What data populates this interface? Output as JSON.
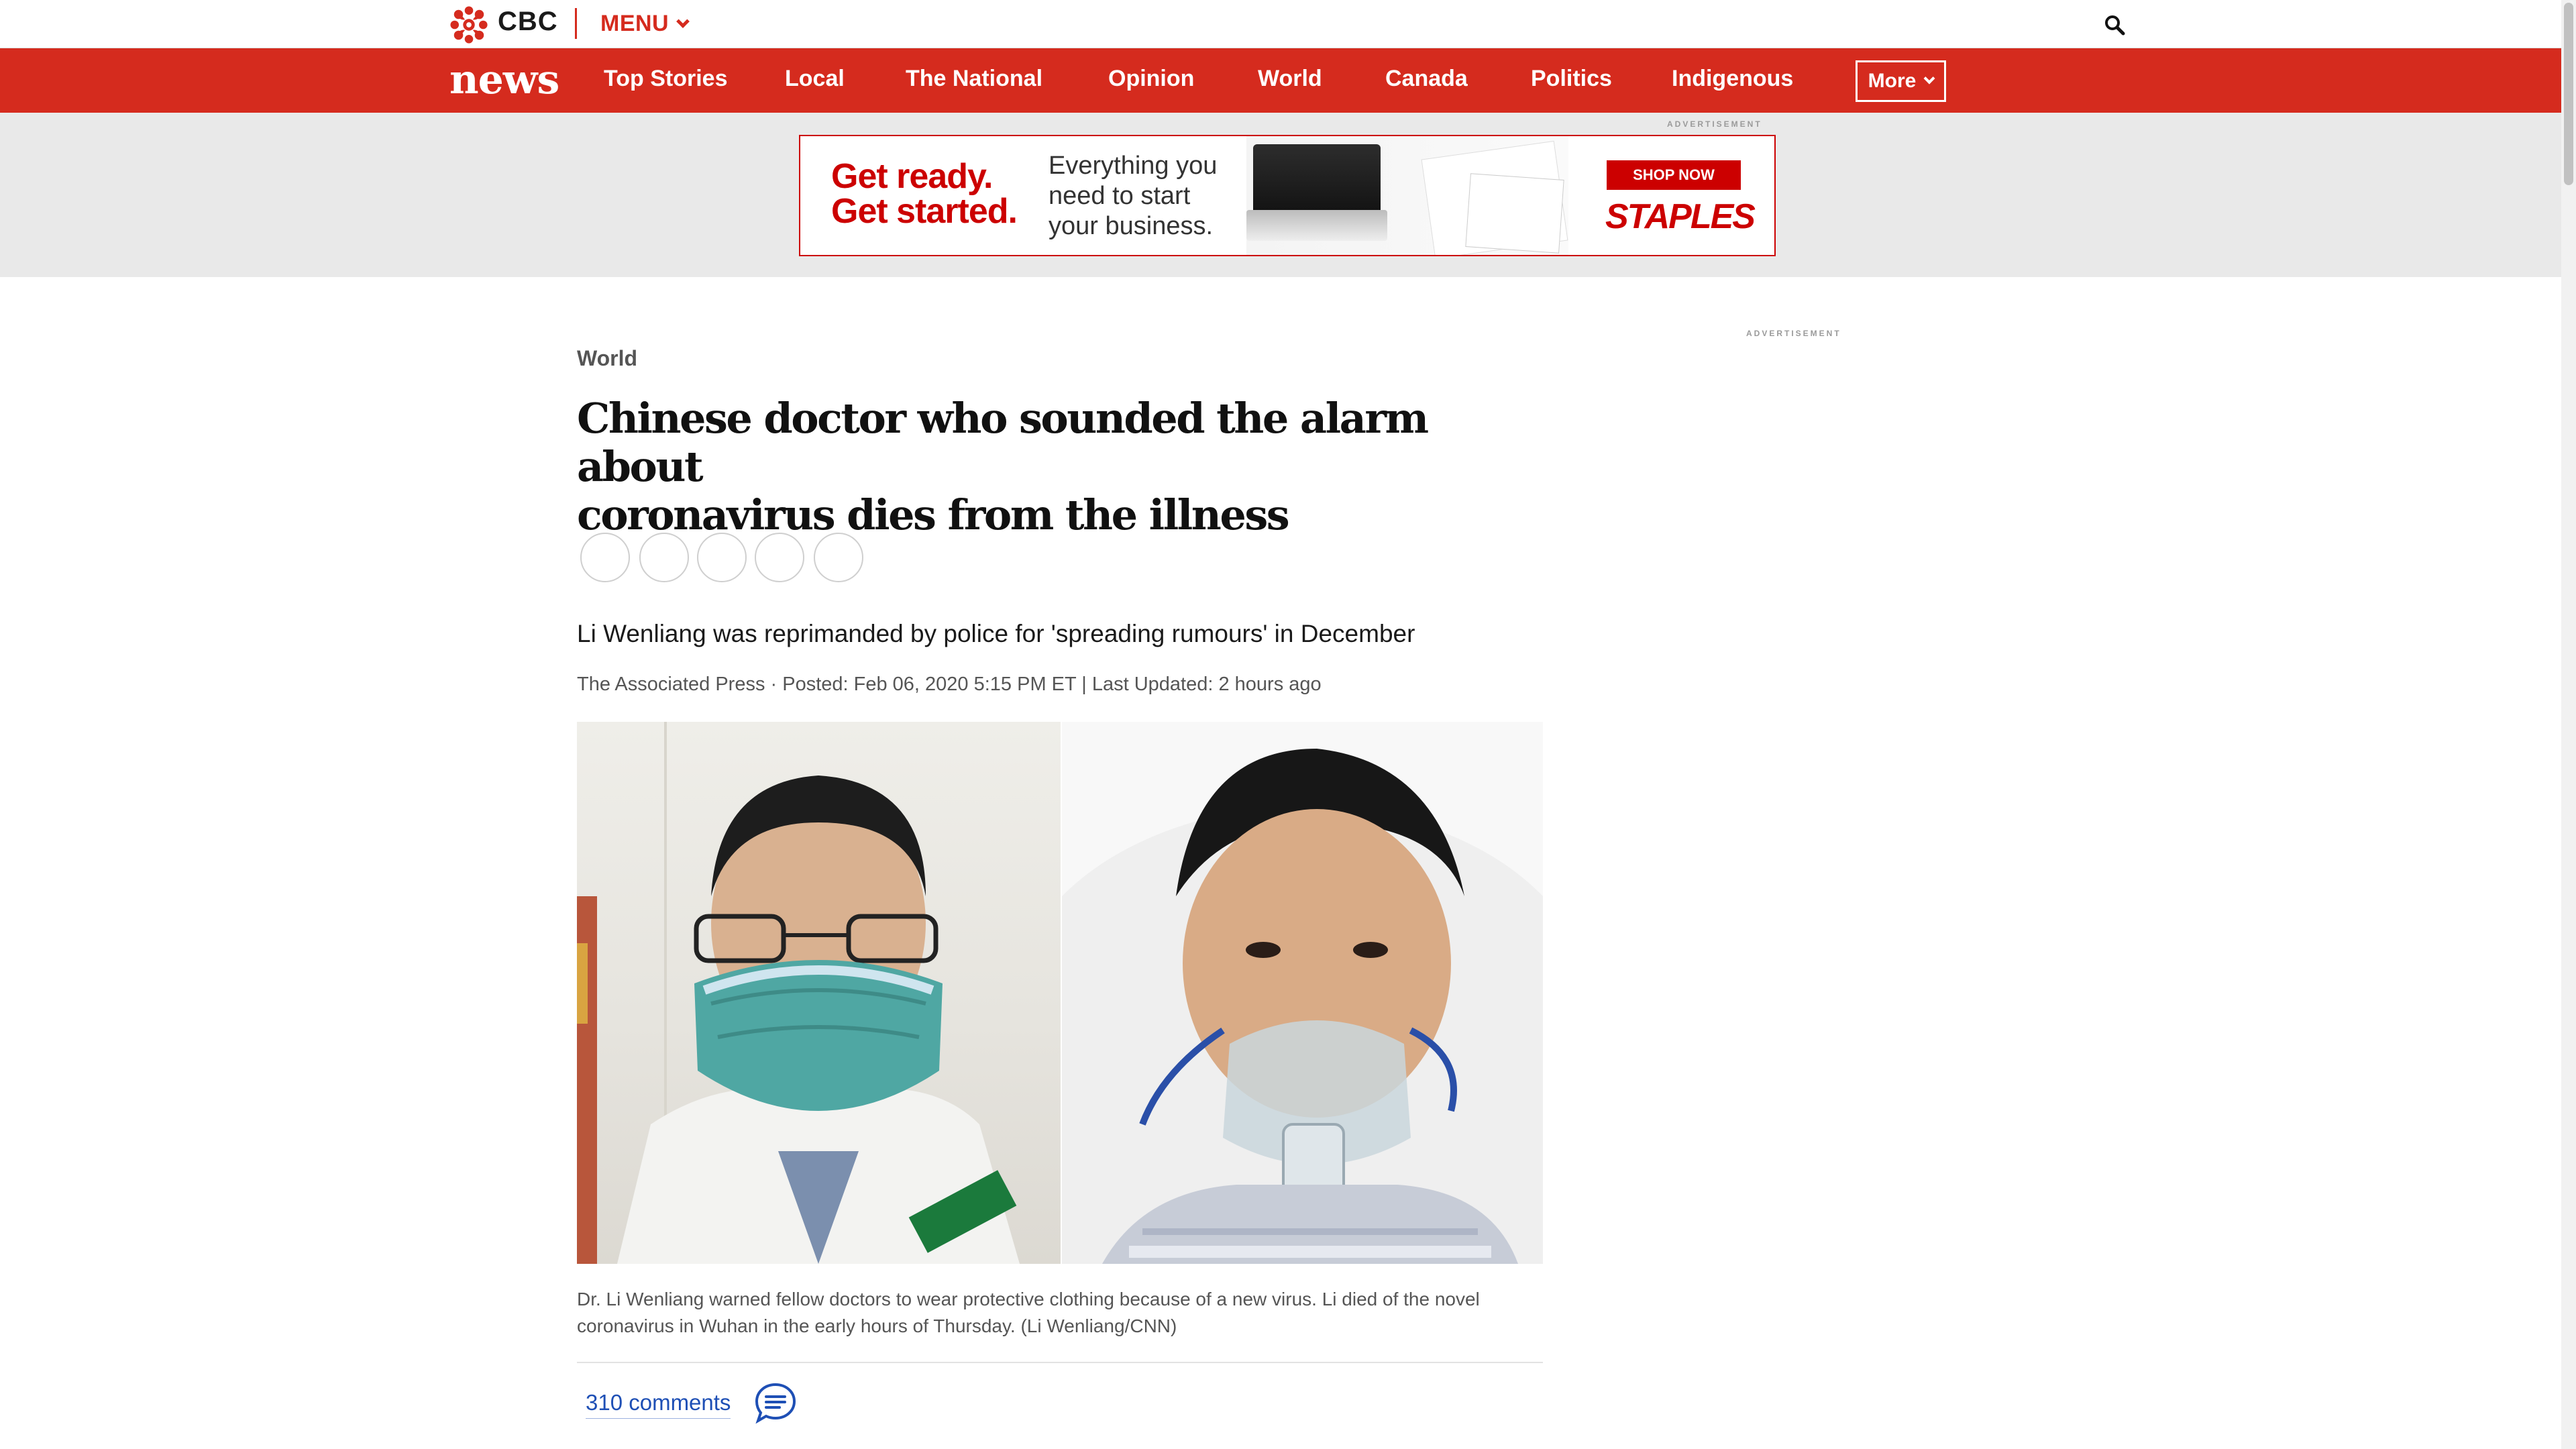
{
  "header": {
    "brand": "CBC",
    "menu_label": "MENU"
  },
  "nav": {
    "logo": "news",
    "items": [
      "Top Stories",
      "Local",
      "The National",
      "Opinion",
      "World",
      "Canada",
      "Politics",
      "Indigenous"
    ],
    "more_label": "More"
  },
  "ad": {
    "label": "ADVERTISEMENT",
    "headline_1": "Get ready.",
    "headline_2": "Get started.",
    "sub_1": "Everything you",
    "sub_2": "need to start",
    "sub_3": "your business.",
    "cta": "SHOP NOW",
    "brand": "STAPLES"
  },
  "sidebar": {
    "ad_label": "ADVERTISEMENT"
  },
  "article": {
    "section": "World",
    "headline_1": "Chinese doctor who sounded the alarm about",
    "headline_2": "coronavirus dies from the illness",
    "deck": "Li Wenliang was reprimanded by police for 'spreading rumours' in December",
    "byline": "The Associated Press · Posted: Feb 06, 2020 5:15 PM ET | Last Updated: 2 hours ago",
    "caption_1": "Dr. Li Wenliang warned fellow doctors to wear protective clothing because of a new virus. Li died of the novel",
    "caption_2": "coronavirus in Wuhan in the early hours of Thursday. (Li Wenliang/CNN)",
    "comments": "310 comments"
  },
  "colors": {
    "brand_red": "#d52b1e",
    "link_blue": "#1e4fb5",
    "ad_red": "#cc0000"
  },
  "icons": {
    "share_buttons": [
      "share-icon-1",
      "share-icon-2",
      "share-icon-3",
      "share-icon-4",
      "share-icon-5"
    ]
  }
}
